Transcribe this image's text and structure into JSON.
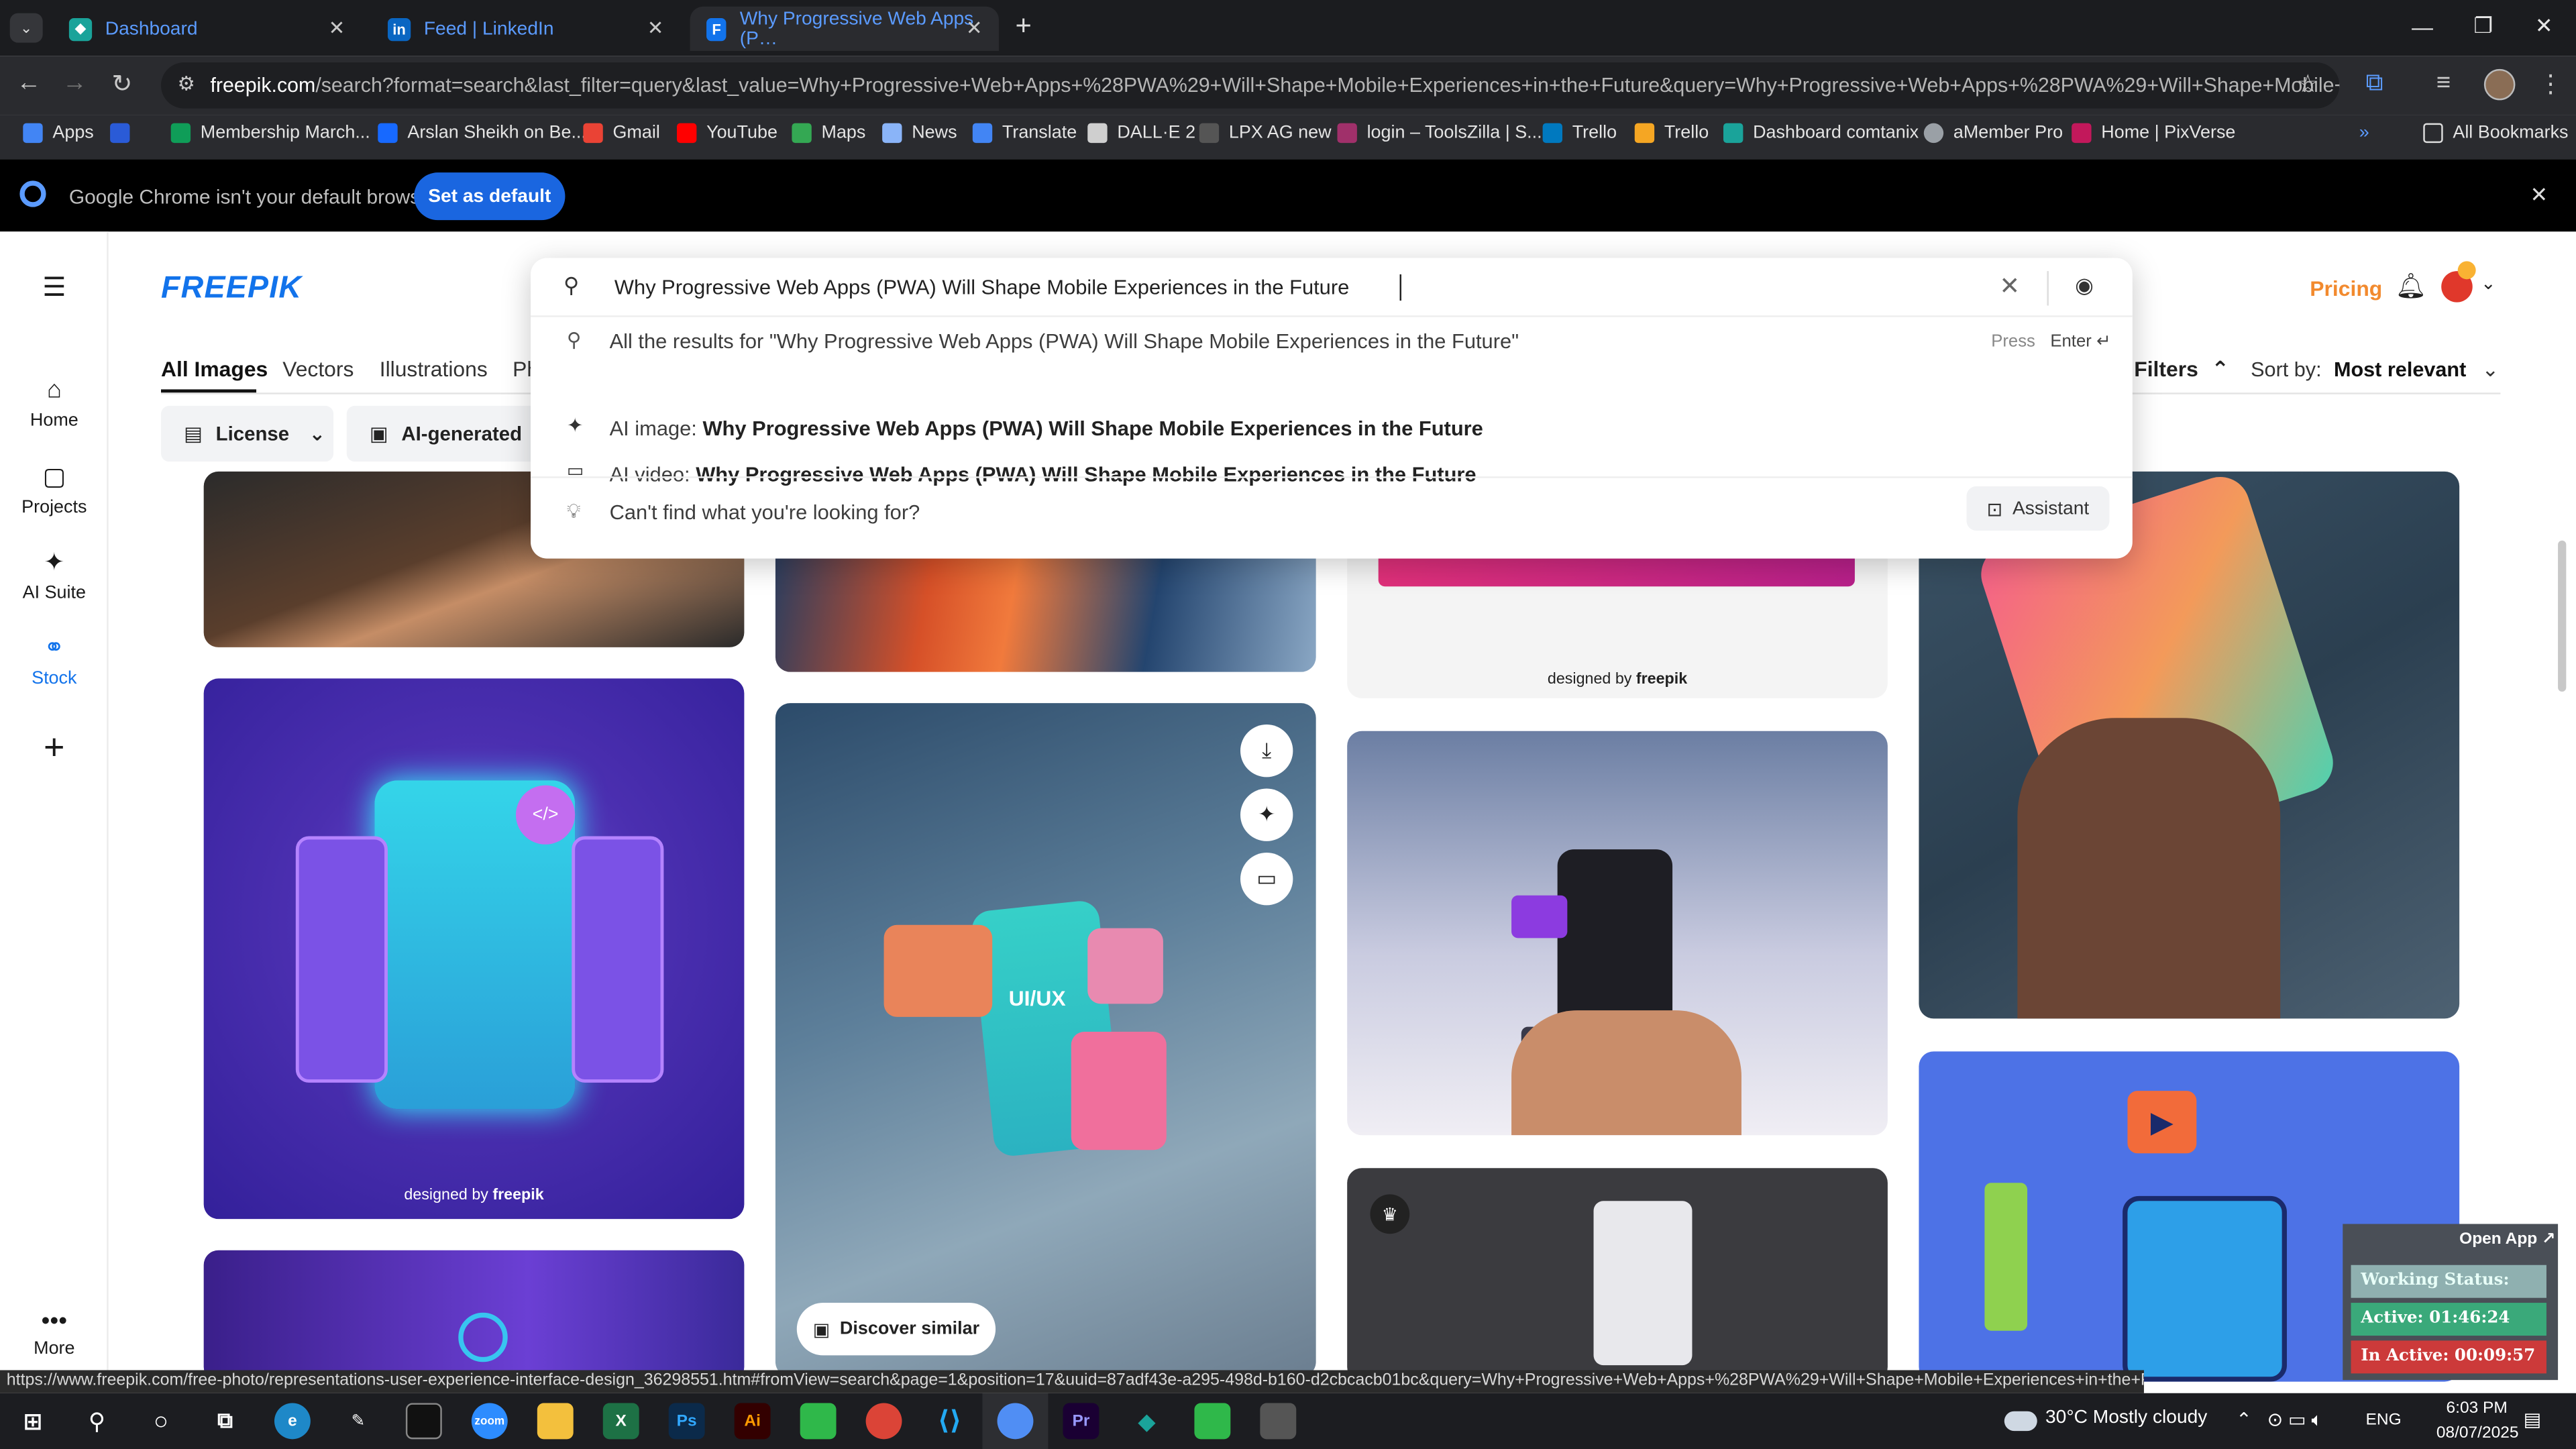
{
  "browser": {
    "tabs": [
      {
        "label": "Dashboard",
        "icon": "dashboard-favicon"
      },
      {
        "label": "Feed | LinkedIn",
        "icon": "linkedin-favicon"
      },
      {
        "label": "Why Progressive Web Apps (P…",
        "icon": "freepik-favicon"
      }
    ],
    "address": {
      "host": "freepik.com",
      "path": "/search?format=search&last_filter=query&last_value=Why+Progressive+Web+Apps+%28PWA%29+Will+Shape+Mobile+Experiences+in+the+Future&query=Why+Progressive+Web+Apps+%28PWA%29+Will+Shape+Mobile+Experien..."
    },
    "bookmarks": [
      "Apps",
      "Membership March...",
      "Arslan Sheikh on Be...",
      "Gmail",
      "YouTube",
      "Maps",
      "News",
      "Translate",
      "DALL·E 2",
      "LPX AG new",
      "login – ToolsZilla | S...",
      "Trello",
      "Trello",
      "Dashboard comtanix",
      "aMember Pro",
      "Home | PixVerse",
      "All Bookmarks"
    ],
    "infobar": {
      "message": "Google Chrome isn't your default browser",
      "button": "Set as default"
    },
    "status_url": "https://www.freepik.com/free-photo/representations-user-experience-interface-design_36298551.htm#fromView=search&page=1&position=17&uuid=87adf43e-a295-498d-b160-d2cbcacb01bc&query=Why+Progressive+Web+Apps+%28PWA%29+Will+Shape+Mobile+Experiences+in+the+Future"
  },
  "sidebar": {
    "items": [
      {
        "label": "Home",
        "icon": "home-icon"
      },
      {
        "label": "Projects",
        "icon": "projects-icon"
      },
      {
        "label": "AI Suite",
        "icon": "ai-suite-icon"
      },
      {
        "label": "Stock",
        "icon": "stock-icon"
      },
      {
        "label": "More",
        "icon": "more-icon"
      }
    ]
  },
  "header": {
    "logo": "FREEPIK",
    "pricing": "Pricing",
    "search": {
      "query": "Why Progressive Web Apps (PWA) Will Shape Mobile Experiences in the Future",
      "all_results": "All the results for \"Why Progressive Web Apps (PWA) Will Shape Mobile Experiences in the Future\"",
      "press": "Press",
      "enter": "Enter ↵",
      "ai_image_prefix": "AI image: ",
      "ai_image_query": "Why Progressive Web Apps (PWA) Will Shape Mobile Experiences in the Future",
      "ai_video_prefix": "AI video: ",
      "ai_video_query": "Why Progressive Web Apps (PWA) Will Shape Mobile Experiences in the Future",
      "cant_find": "Can't find what you're looking for?",
      "assistant": "Assistant"
    }
  },
  "content_tabs": [
    "All Images",
    "Vectors",
    "Illustrations",
    "Ph"
  ],
  "filters": {
    "license": "License",
    "ai_generated": "AI-generated",
    "filters": "Filters",
    "sort_label": "Sort by:",
    "sort_value": "Most relevant"
  },
  "cards": {
    "watermark_prefix": "designed by",
    "watermark_brand": "freepik",
    "discover": "Discover similar",
    "ui_ux": "UI/UX"
  },
  "widget": {
    "open_app": "Open App ↗",
    "working": "Working Status: Active",
    "active": "Active: 01:46:24",
    "inactive": "In Active: 00:09:57"
  },
  "taskbar": {
    "weather": "30°C  Mostly cloudy",
    "lang": "ENG",
    "time": "6:03 PM",
    "date": "08/07/2025"
  }
}
